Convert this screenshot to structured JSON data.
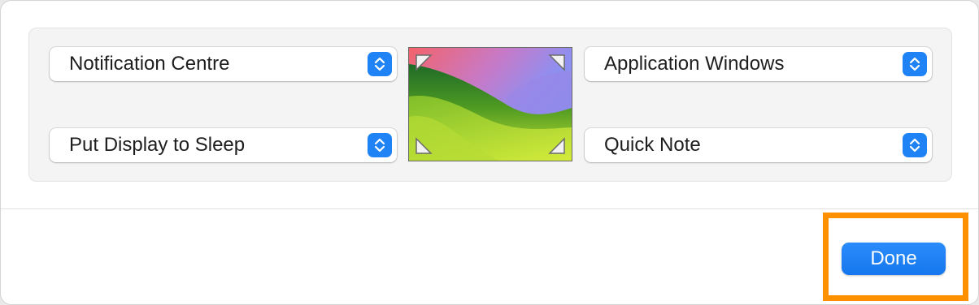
{
  "hot_corners": {
    "top_left": {
      "value": "Notification Centre"
    },
    "top_right": {
      "value": "Application Windows"
    },
    "bottom_left": {
      "value": "Put Display to Sleep"
    },
    "bottom_right": {
      "value": "Quick Note"
    }
  },
  "footer": {
    "done_label": "Done"
  },
  "colors": {
    "accent": "#1f82f5",
    "highlight": "#ff9000"
  },
  "icons": {
    "stepper": "up-down-chevron-icon",
    "corner": "corner-arrow-icon"
  }
}
